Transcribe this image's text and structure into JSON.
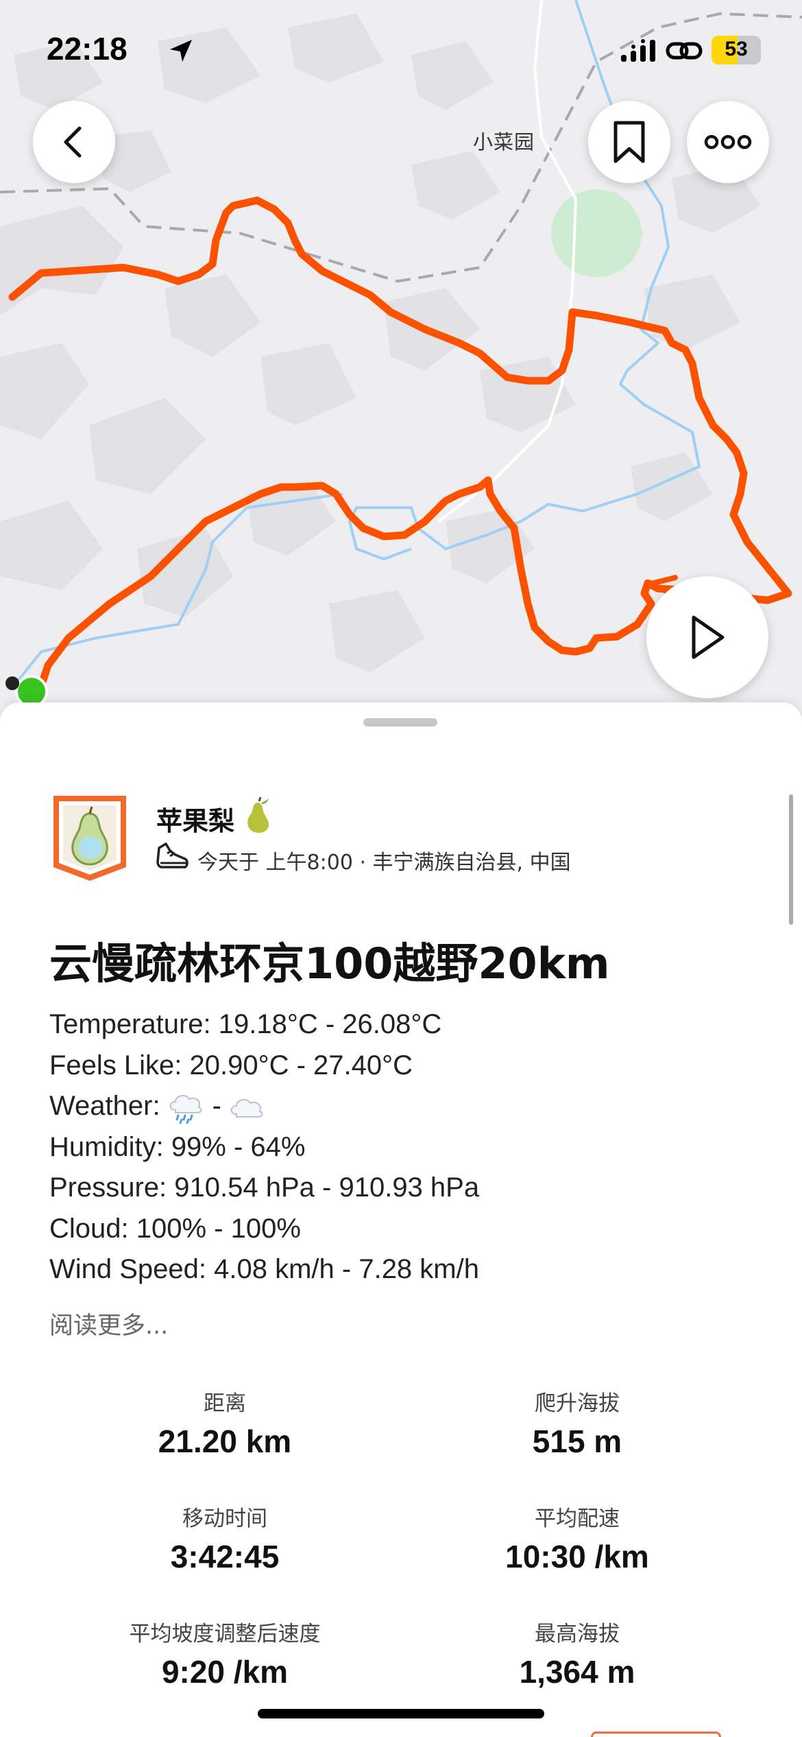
{
  "status_bar": {
    "time": "22:18",
    "battery_level": "53",
    "battery_fraction": 0.53,
    "icons": [
      "location-arrow-icon",
      "cellular-signal-icon",
      "link-icon",
      "battery-icon"
    ]
  },
  "map": {
    "place_label": "小菜园",
    "route_color": "#fc5200",
    "start_marker_color": "#3ac41f",
    "water_color": "#9fd0f3",
    "park_color": "#cdecd2"
  },
  "nav": {
    "back_icon": "chevron-left-icon",
    "bookmark_icon": "bookmark-icon",
    "more_icon": "more-icon",
    "play_icon": "play-icon"
  },
  "activity": {
    "athlete_name": "苹果梨",
    "athlete_emoji": "pear-icon",
    "sport_icon": "shoe-icon",
    "meta": "今天于 上午8:00 · 丰宁满族自治县, 中国",
    "title": "云慢疏林环京100越野20km",
    "description": {
      "temperature": "Temperature: 19.18°C - 26.08°C",
      "feels_like": "Feels Like: 20.90°C - 27.40°C",
      "weather_label": "Weather:",
      "weather_sep": "-",
      "weather_icons": [
        "rain-cloud-icon",
        "cloud-icon"
      ],
      "humidity": "Humidity: 99% - 64%",
      "pressure": "Pressure: 910.54 hPa - 910.93 hPa",
      "cloud": "Cloud: 100% - 100%",
      "wind": "Wind Speed: 4.08 km/h - 7.28 km/h"
    },
    "read_more": "阅读更多..."
  },
  "stats": [
    {
      "label": "距离",
      "value": "21.20 km"
    },
    {
      "label": "爬升海拔",
      "value": "515 m"
    },
    {
      "label": "移动时间",
      "value": "3:42:45"
    },
    {
      "label": "平均配速",
      "value": "10:30 /km"
    },
    {
      "label": "平均坡度调整后速度",
      "value": "9:20 /km"
    },
    {
      "label": "最高海拔",
      "value": "1,364 m"
    }
  ]
}
